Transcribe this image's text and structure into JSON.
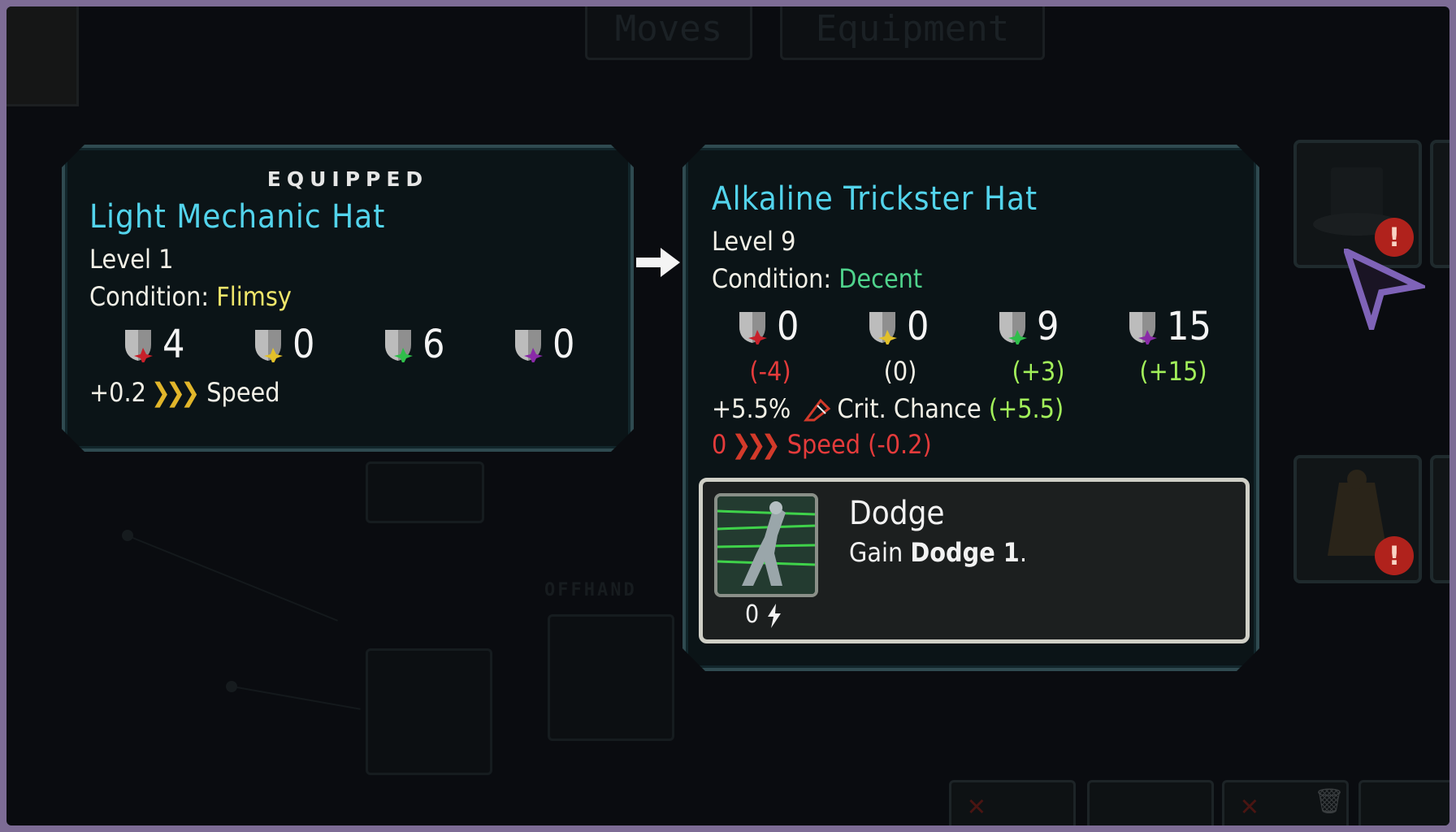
{
  "tabs": [
    "Moves",
    "Equipment"
  ],
  "offhand_label": "OFFHAND",
  "equipped": {
    "header": "EQUIPPED",
    "name": "Light Mechanic Hat",
    "level": "Level 1",
    "condition_label": "Condition:",
    "condition_value": "Flimsy",
    "stats": [
      "4",
      "0",
      "6",
      "0"
    ],
    "speed_value": "+0.2",
    "speed_label": "Speed"
  },
  "compare": {
    "name": "Alkaline Trickster Hat",
    "level": "Level 9",
    "condition_label": "Condition:",
    "condition_value": "Decent",
    "stats": [
      "0",
      "0",
      "9",
      "15"
    ],
    "deltas": [
      "(-4)",
      "(0)",
      "(+3)",
      "(+15)"
    ],
    "crit_value": "+5.5%",
    "crit_label": "Crit. Chance",
    "crit_delta": "(+5.5)",
    "speed_value": "0",
    "speed_label": "Speed",
    "speed_delta": "(-0.2)"
  },
  "ability": {
    "name": "Dodge",
    "desc_prefix": "Gain",
    "desc_bold": "Dodge 1",
    "desc_suffix": ".",
    "cost": "0"
  },
  "colors": {
    "title": "#53d4ec",
    "condition_flimsy": "#f0e66a",
    "condition_decent": "#4fd38c",
    "negative": "#e43b3b",
    "positive": "#a2f05a",
    "panel_border": "#2f4a50"
  },
  "icons": [
    "shield-red-icon",
    "shield-yellow-icon",
    "shield-green-icon",
    "shield-purple-icon",
    "speed-chevron-icon",
    "crit-icon",
    "energy-icon",
    "compare-arrow-icon",
    "cursor-icon",
    "alert-icon",
    "top-hat-icon"
  ]
}
